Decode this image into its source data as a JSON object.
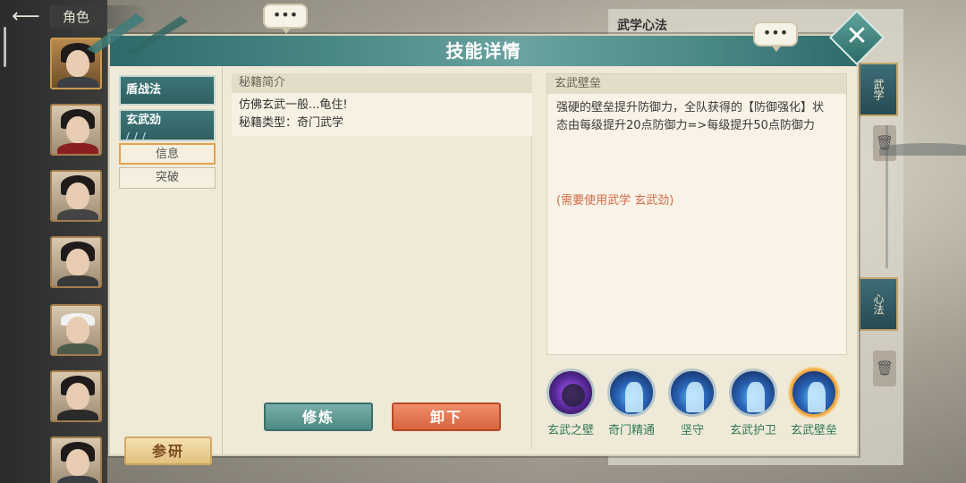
{
  "nav": {
    "back_icon": "back-arrow-icon",
    "role_tab": "角色"
  },
  "background_panel": {
    "heading": "武学心法",
    "tags": [
      "武学",
      "心法"
    ]
  },
  "dialog": {
    "title": "技能详情",
    "close_icon": "close-icon",
    "chat_bubble": "•••",
    "skill_list": [
      {
        "name": "盾战法"
      },
      {
        "name": "玄武劲",
        "sub_tabs": [
          "信息",
          "突破"
        ],
        "selected_sub_tab": "信息"
      }
    ],
    "buttons": {
      "research": "参研",
      "practice": "修炼",
      "unload": "卸下"
    },
    "book": {
      "intro_header": "秘籍简介",
      "intro_line1": "仿佛玄武一般...龟住!",
      "intro_line2": "秘籍类型：奇门武学"
    },
    "effect": {
      "header": "玄武壁垒",
      "description": "强硬的壁垒提升防御力，全队获得的【防御强化】状态由每级提升20点防御力=>每级提升50点防御力",
      "requirement": "(需要使用武学 玄武劲)"
    },
    "skill_icons": [
      {
        "label": "玄武之壁",
        "icon": "purple-shield-skill-icon"
      },
      {
        "label": "奇门精通",
        "icon": "blue-figure-skill-icon"
      },
      {
        "label": "坚守",
        "icon": "blue-figure-skill-icon"
      },
      {
        "label": "玄武护卫",
        "icon": "blue-figure-skill-icon"
      },
      {
        "label": "玄武壁垒",
        "icon": "blue-figure-skill-icon",
        "selected": true
      }
    ]
  }
}
